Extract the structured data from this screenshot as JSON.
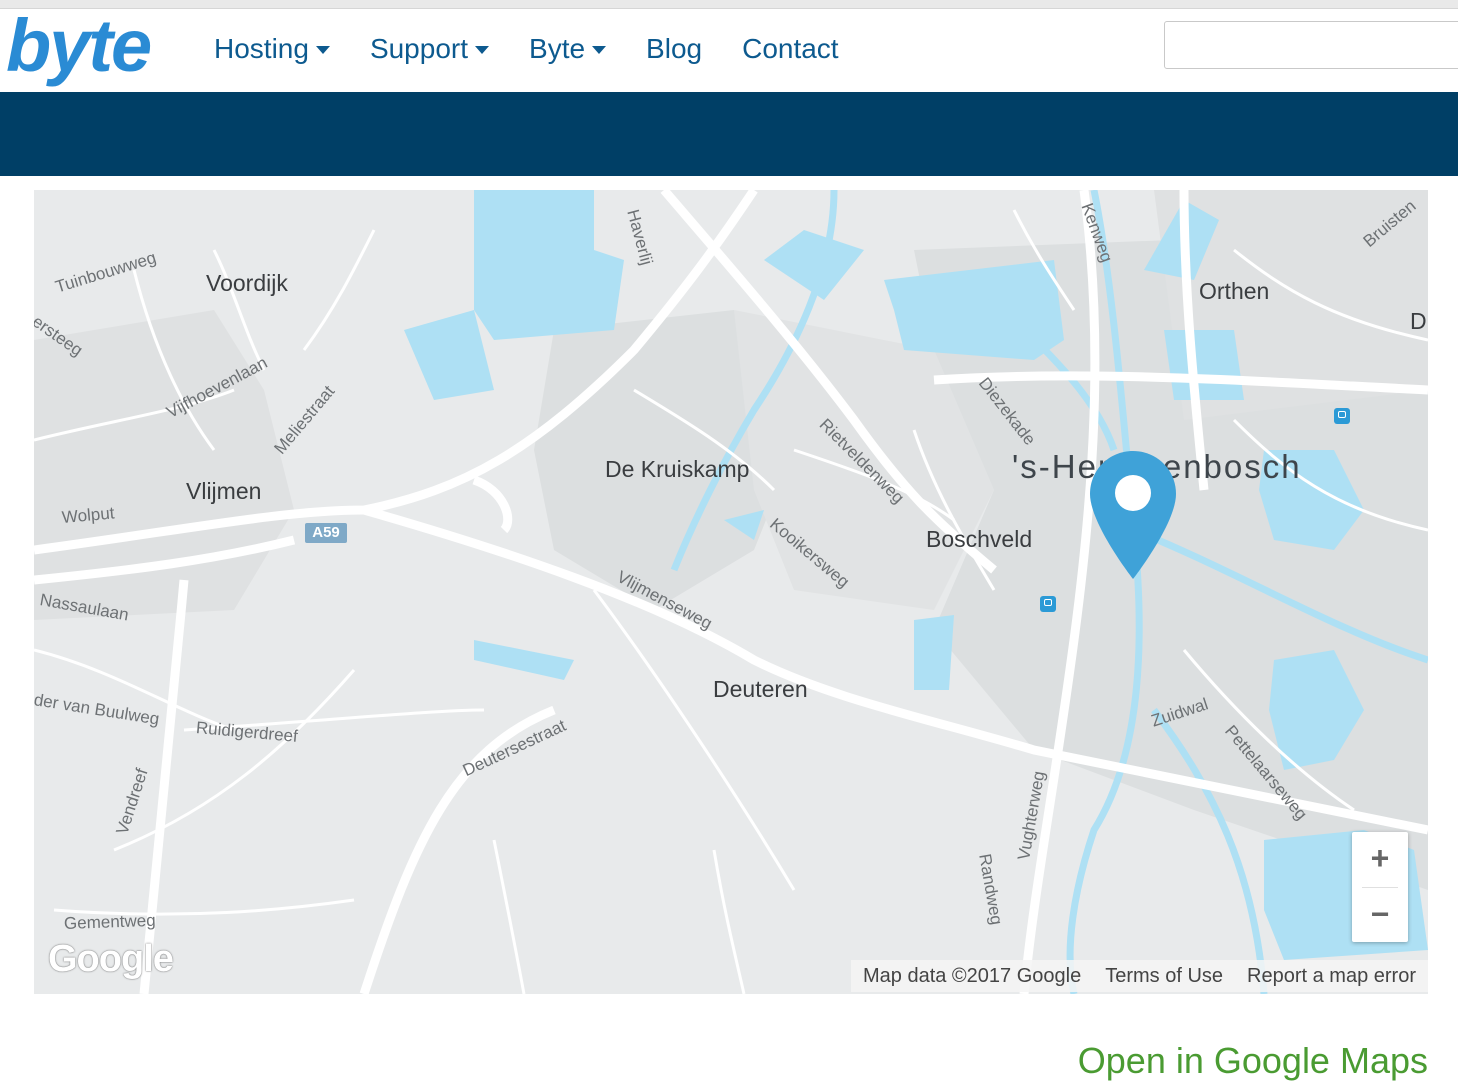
{
  "header": {
    "logo": "byte",
    "nav": [
      {
        "label": "Hosting",
        "dropdown": true
      },
      {
        "label": "Support",
        "dropdown": true
      },
      {
        "label": "Byte",
        "dropdown": true
      },
      {
        "label": "Blog",
        "dropdown": false
      },
      {
        "label": "Contact",
        "dropdown": false
      }
    ],
    "search_value": ""
  },
  "map": {
    "places": {
      "voordijk": "Voordijk",
      "vlijmen": "Vlijmen",
      "de_kruiskamp": "De Kruiskamp",
      "boschveld": "Boschveld",
      "deuteren": "Deuteren",
      "orthen": "Orthen",
      "den_bosch": "'s-Hertogenbosch",
      "d_partial": "D"
    },
    "roads": {
      "tuinbouwweg": "Tuinbouwweg",
      "steeg": "ersteeg",
      "vijfhoevenlaan": "Vijfhoevenlaan",
      "meliestraat": "Meliestraat",
      "wolput": "Wolput",
      "nassaulaan": "Nassaulaan",
      "buulweg": "der van Buulweg",
      "ruidigerdreef": "Ruidigerdreef",
      "vendreef": "Vendreef",
      "gementweg": "Gementweg",
      "deutersestraat": "Deutersestraat",
      "vlijmenseweg": "Vlijmenseweg",
      "haverlij": "Haverlij",
      "rietveldenweg": "Rietveldenweg",
      "kooikersweg": "Kooikersweg",
      "diezekade": "Diezekade",
      "kenweg": "Kenweg",
      "randweg": "Randweg",
      "vughterweg": "Vughterweg",
      "zuidwal": "Zuidwal",
      "pettelaarseweg": "Pettelaarseweg",
      "bruistensingel": "Bruisten"
    },
    "highway_shield": "A59",
    "zoom_in": "+",
    "zoom_out": "−",
    "google_logo": "Google",
    "attribution": {
      "map_data": "Map data ©2017 Google",
      "terms": "Terms of Use",
      "report": "Report a map error"
    },
    "icons": {
      "marker": "map-pin-icon",
      "transit": "train-station-icon"
    },
    "colors": {
      "water": "#aee0f4",
      "marker": "#3fa2d8",
      "banner": "#003f66",
      "link": "#4a9b32"
    }
  },
  "open_in_maps": "Open in Google Maps"
}
